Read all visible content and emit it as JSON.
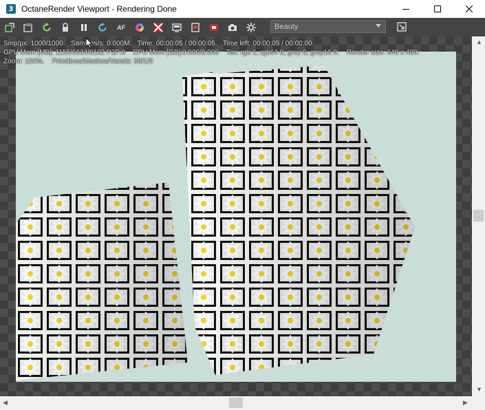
{
  "window": {
    "app_icon_glyph": "3",
    "title": "OctaneRender Viewport - Rendering Done"
  },
  "toolbar": {
    "buttons": [
      {
        "name": "recenter-view-icon"
      },
      {
        "name": "save-render-icon"
      },
      {
        "name": "restart-render-icon"
      },
      {
        "name": "lock-viewport-icon"
      },
      {
        "name": "pause-render-icon"
      },
      {
        "name": "update-scene-icon"
      },
      {
        "name": "autofocus-icon",
        "glyph": "AF"
      },
      {
        "name": "color-picker-icon"
      },
      {
        "name": "material-picker-icon"
      },
      {
        "name": "viewport-settings-icon"
      },
      {
        "name": "film-settings-icon"
      },
      {
        "name": "snapshot-icon"
      },
      {
        "name": "camera-icon"
      },
      {
        "name": "options-icon"
      }
    ],
    "render_pass": "Beauty"
  },
  "status": {
    "line1": "Smp/px: 1000/1000.   Samples/s: 0.000M.   Time: 00:00:05 / 00:00:05.   Time left: 00:00:05 / 00:00:00.",
    "line2": "GPU Mem [MB]: 1155/6634/8192 P2P:0    CPU Mem [GB]:0.000/8.000    Tex: rgb 1, rgb64 0, grey 0, grey16 0.    Render size: 640 x 480.",
    "line3": "Zoom: 100%.    Primitives/Meshes/Voxels: 36/1/0"
  },
  "colors": {
    "toolbar_bg": "#444444",
    "render_bg": "#c8dcd8",
    "overlay_text": "#e8e8e8"
  }
}
